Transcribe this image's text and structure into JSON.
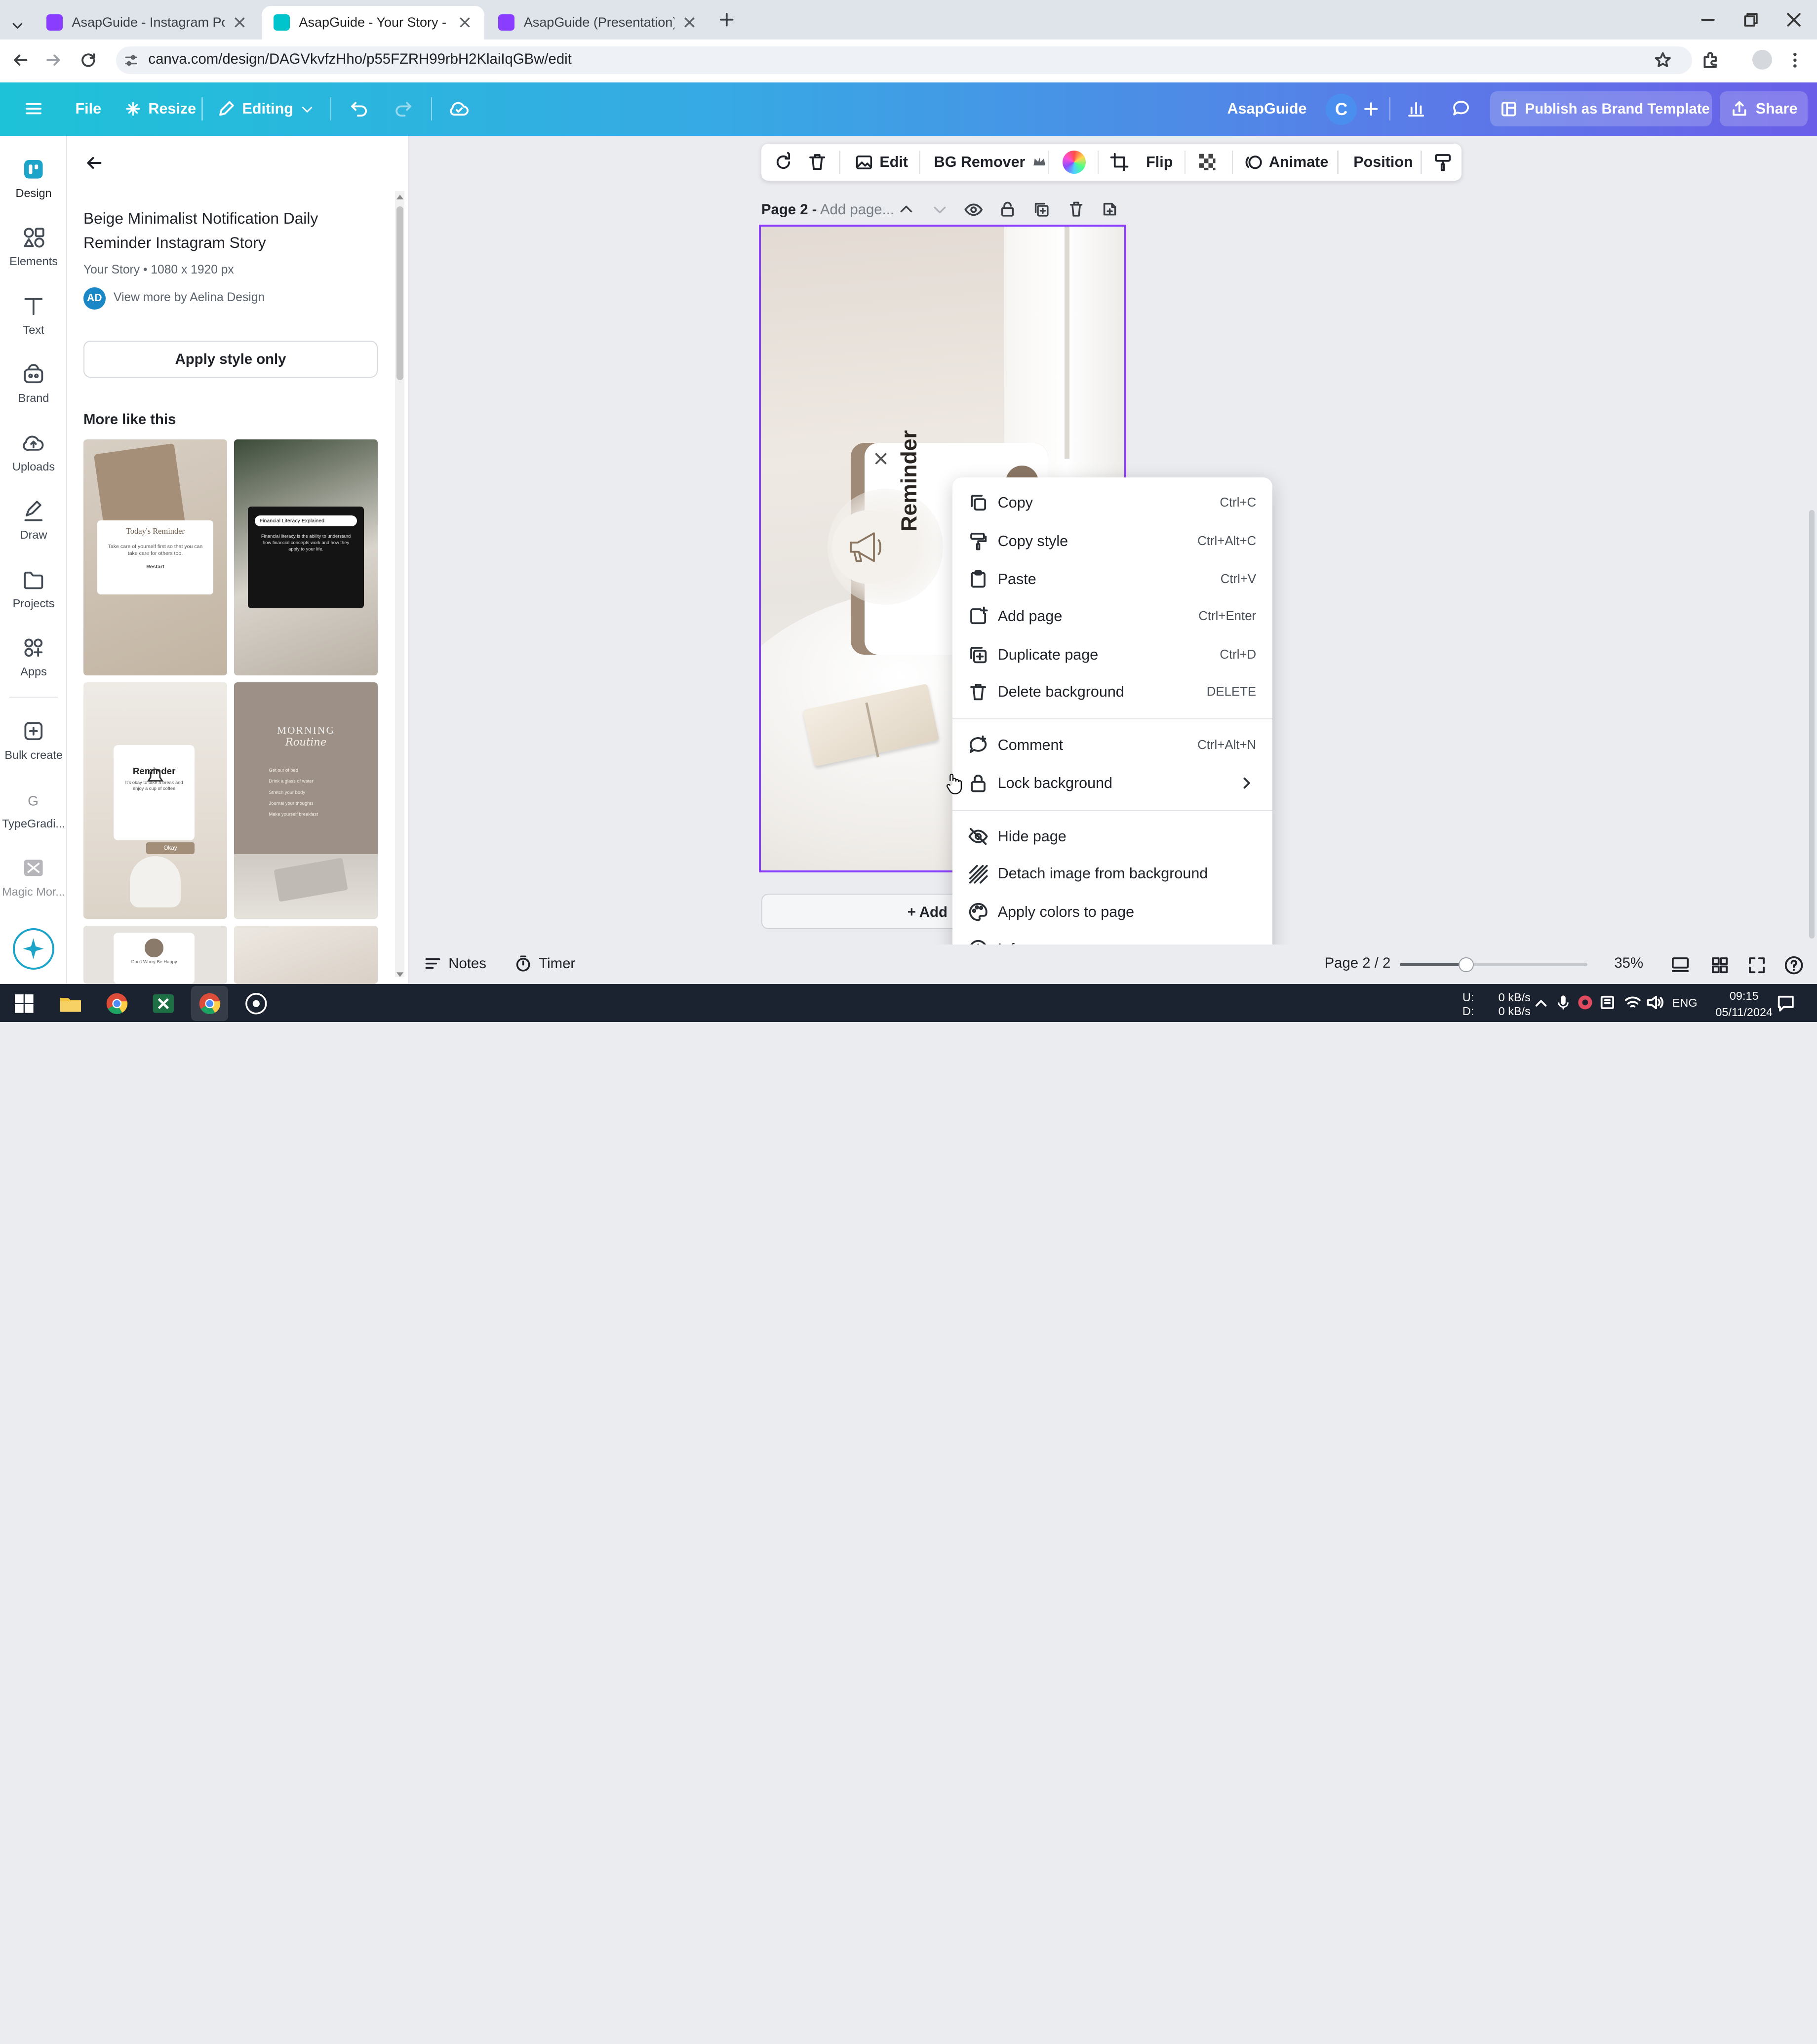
{
  "browser": {
    "tabs": [
      {
        "title": "AsapGuide - Instagram Post",
        "active": false
      },
      {
        "title": "AsapGuide - Your Story - Canva",
        "active": true
      },
      {
        "title": "AsapGuide (Presentation) - Pre",
        "active": false
      }
    ],
    "url": "canva.com/design/DAGVkvfzHho/p55FZRH99rbH2KlaiIqGBw/edit"
  },
  "topbar": {
    "file": "File",
    "resize": "Resize",
    "editing": "Editing",
    "team_name": "AsapGuide",
    "avatar_letter": "C",
    "publish": "Publish as Brand Template",
    "share": "Share"
  },
  "rail": {
    "items": [
      "Design",
      "Elements",
      "Text",
      "Brand",
      "Uploads",
      "Draw",
      "Projects",
      "Apps",
      "Bulk create",
      "TypeGradi...",
      "Magic Mor..."
    ]
  },
  "panel": {
    "title": "Beige Minimalist Notification Daily Reminder Instagram Story",
    "meta": "Your Story • 1080 x 1920 px",
    "author_initials": "AD",
    "author_link": "View more by Aelina Design",
    "apply_button": "Apply style only",
    "more_heading": "More like this",
    "thumbs": [
      {
        "title": "Today's Reminder",
        "body": "Take care of yourself first so that you can take care for others too.",
        "cta": "Restart"
      },
      {
        "title": "Financial Literacy Explained",
        "body": "Financial literacy is the ability to understand how financial concepts work and how they apply to your life."
      },
      {
        "title": "Reminder",
        "body": "It's okay to take a break and enjoy a cup of coffee",
        "cta": "Okay"
      },
      {
        "title": "MORNING",
        "script": "Routine",
        "items": [
          "Get out of bed",
          "Drink a glass of water",
          "Stretch your body",
          "Journal your thoughts",
          "Make yourself breakfast"
        ]
      },
      {
        "title": "Don't Worry Be Happy"
      },
      {
        "title": ""
      }
    ]
  },
  "context_toolbar": {
    "edit": "Edit",
    "bg_remover": "BG Remover",
    "flip": "Flip",
    "animate": "Animate",
    "position": "Position"
  },
  "page_header": {
    "label": "Page 2 -",
    "placeholder": "Add page..."
  },
  "design": {
    "reminder_text": "Reminder"
  },
  "add_page": "+ Add p",
  "context_menu": {
    "groups": [
      [
        {
          "label": "Copy",
          "shortcut": "Ctrl+C",
          "icon": "copy-icon"
        },
        {
          "label": "Copy style",
          "shortcut": "Ctrl+Alt+C",
          "icon": "paint-roller-icon"
        },
        {
          "label": "Paste",
          "shortcut": "Ctrl+V",
          "icon": "clipboard-icon"
        },
        {
          "label": "Add page",
          "shortcut": "Ctrl+Enter",
          "icon": "add-page-icon"
        },
        {
          "label": "Duplicate page",
          "shortcut": "Ctrl+D",
          "icon": "duplicate-icon"
        },
        {
          "label": "Delete background",
          "shortcut": "DELETE",
          "icon": "trash-icon"
        }
      ],
      [
        {
          "label": "Comment",
          "shortcut": "Ctrl+Alt+N",
          "icon": "comment-icon"
        },
        {
          "label": "Lock background",
          "shortcut": "",
          "icon": "lock-icon",
          "submenu": true
        }
      ],
      [
        {
          "label": "Hide page",
          "shortcut": "",
          "icon": "eye-off-icon"
        },
        {
          "label": "Detach image from background",
          "shortcut": "",
          "icon": "detach-icon"
        },
        {
          "label": "Apply colors to page",
          "shortcut": "",
          "icon": "palette-icon"
        },
        {
          "label": "Info",
          "shortcut": "",
          "icon": "info-icon"
        }
      ]
    ]
  },
  "bottombar": {
    "notes": "Notes",
    "timer": "Timer",
    "page_indicator": "Page 2 / 2",
    "zoom": "35%",
    "zoom_fraction": 0.35
  },
  "taskbar": {
    "net_up": "0 kB/s",
    "net_down": "0 kB/s",
    "up_label": "U:",
    "down_label": "D:",
    "lang": "ENG",
    "time": "09:15",
    "date": "05/11/2024"
  },
  "colors": {
    "accent": "#8b3dff",
    "brand_teal": "#1ec2d8",
    "brand_purple": "#6a5ee8"
  }
}
